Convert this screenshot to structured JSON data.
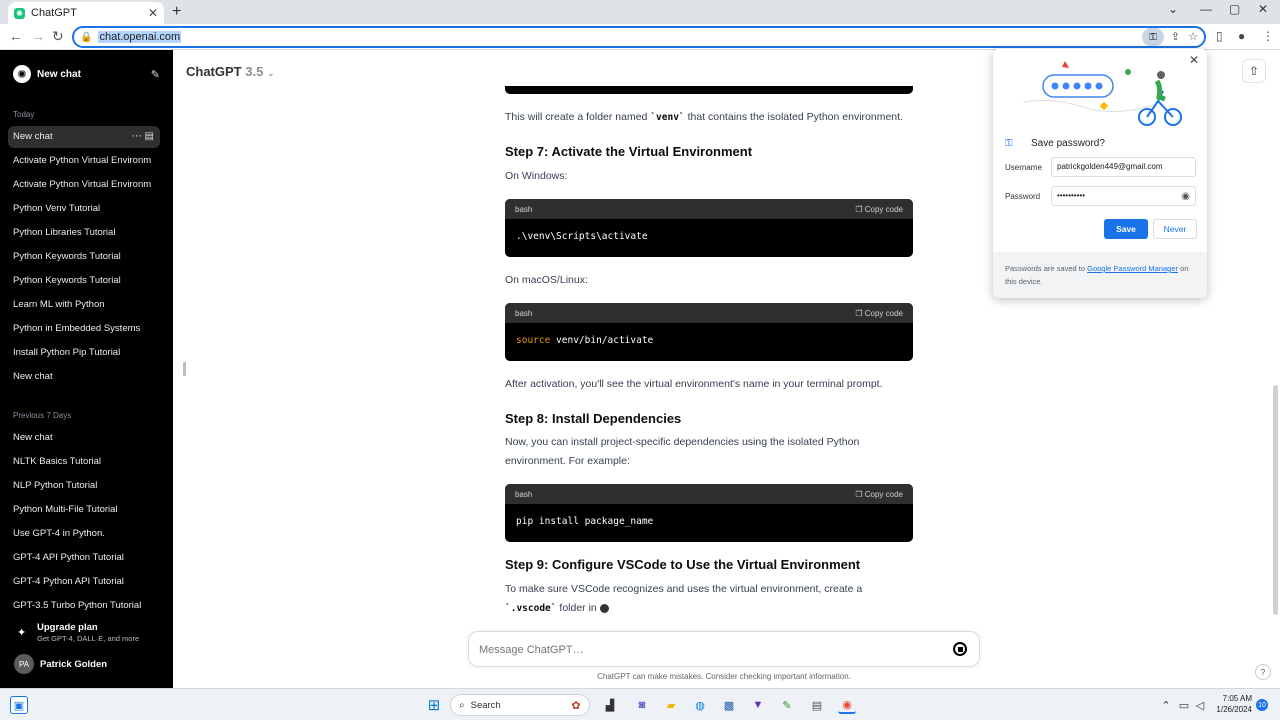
{
  "browser": {
    "tab_title": "ChatGPT",
    "url": "chat.openai.com"
  },
  "sidebar": {
    "new_chat_label": "New chat",
    "section_today": "Today",
    "today_items": [
      "New chat",
      "Activate Python Virtual Environm",
      "Activate Python Virtual Environm",
      "Python Venv Tutorial",
      "Python Libraries Tutorial",
      "Python Keywords Tutorial",
      "Python Keywords Tutorial",
      "Learn ML with Python",
      "Python in Embedded Systems",
      "Install Python Pip Tutorial",
      "New chat"
    ],
    "section_prev7": "Previous 7 Days",
    "prev7_items": [
      "New chat",
      "NLTK Basics Tutorial",
      "NLP Python Tutorial",
      "Python Multi-File Tutorial",
      "Use GPT-4 in Python.",
      "GPT-4 API Python Tutorial",
      "GPT-4 Python API Tutorial",
      "GPT-3.5 Turbo Python Tutorial"
    ],
    "upgrade_title": "Upgrade plan",
    "upgrade_sub": "Get GPT-4, DALL·E, and more",
    "user_initials": "PA",
    "user_name": "Patrick Golden"
  },
  "main": {
    "model_name": "ChatGPT",
    "model_version": "3.5",
    "p_venv_pre": "This will create a folder named ",
    "p_venv_code": "`venv`",
    "p_venv_post": " that contains the isolated Python environment.",
    "step7": "Step 7: Activate the Virtual Environment",
    "on_windows": "On Windows:",
    "code_lang": "bash",
    "copy_code": "Copy code",
    "code_windows": ".\\venv\\Scripts\\activate",
    "on_mac": "On macOS/Linux:",
    "code_mac_kw": "source",
    "code_mac_rest": " venv/bin/activate",
    "after_activation": "After activation, you'll see the virtual environment's name in your terminal prompt.",
    "step8": "Step 8: Install Dependencies",
    "deps_line1": "Now, you can install project-specific dependencies using the isolated Python",
    "deps_line2": "environment. For example:",
    "code_pip": "pip install package_name",
    "step9": "Step 9: Configure VSCode to Use the Virtual Environment",
    "vscode_line1": "To make sure VSCode recognizes and uses the virtual environment, create a",
    "vscode_code": "`.vscode`",
    "vscode_post": " folder in ",
    "composer_placeholder": "Message ChatGPT…",
    "disclaimer": "ChatGPT can make mistakes. Consider checking important information.",
    "help": "?"
  },
  "password_popup": {
    "title": "Save password?",
    "username_label": "Username",
    "username_value": "patrickgolden449@gmail.com",
    "password_label": "Password",
    "password_value": "••••••••••",
    "save_label": "Save",
    "never_label": "Never",
    "foot_pre": "Passwords are saved to ",
    "foot_link": "Google Password Manager",
    "foot_post": " on this device."
  },
  "taskbar": {
    "search_label": "Search",
    "time": "7:05 AM",
    "date": "1/26/2024",
    "badge": "10"
  },
  "colors": {
    "sidebar_bg": "#000000",
    "accent_blue": "#1a73e8",
    "code_keyword": "#e9950c"
  }
}
